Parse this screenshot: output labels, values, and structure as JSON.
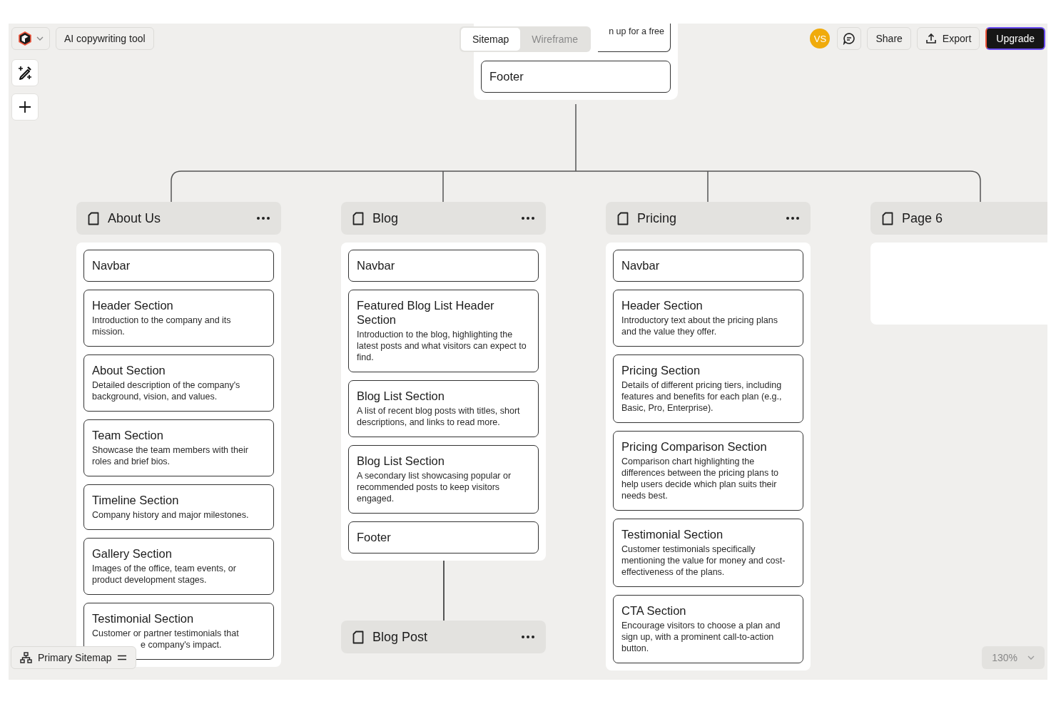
{
  "toolbar": {
    "project": "AI copywriting tool"
  },
  "view_tabs": [
    {
      "label": "Sitemap",
      "selected": true
    },
    {
      "label": "Wireframe",
      "selected": false
    }
  ],
  "header_actions": {
    "avatar": "VS",
    "share": "Share",
    "export": "Export",
    "upgrade": "Upgrade"
  },
  "root": {
    "cut_text": "n up for a free",
    "sections": [
      {
        "title": "Footer"
      }
    ]
  },
  "pages": [
    {
      "title": "About Us",
      "menu": true,
      "sections": [
        {
          "title": "Navbar"
        },
        {
          "title": "Header Section",
          "description": "Introduction to the company and its mission."
        },
        {
          "title": "About Section",
          "description": "Detailed description of the company's background, vision, and values."
        },
        {
          "title": "Team Section",
          "description": "Showcase the team members with their roles and brief bios."
        },
        {
          "title": "Timeline Section",
          "description": "Company history and major milestones."
        },
        {
          "title": "Gallery Section",
          "description": "Images of the office, team events, or product development stages."
        },
        {
          "title": "Testimonial Section",
          "description": "Customer or partner testimonials that",
          "description_tail": "e company's impact."
        }
      ]
    },
    {
      "title": "Blog",
      "menu": true,
      "sections": [
        {
          "title": "Navbar"
        },
        {
          "title": "Featured Blog List Header Section",
          "description": "Introduction to the blog, highlighting the latest posts and what visitors can expect to find."
        },
        {
          "title": "Blog List Section",
          "description": "A list of recent blog posts with titles, short descriptions, and links to read more."
        },
        {
          "title": "Blog List Section",
          "description": "A secondary list showcasing popular or recommended posts to keep visitors engaged."
        },
        {
          "title": "Footer"
        }
      ],
      "children": [
        {
          "title": "Blog Post",
          "menu": true
        }
      ]
    },
    {
      "title": "Pricing",
      "menu": true,
      "sections": [
        {
          "title": "Navbar"
        },
        {
          "title": "Header Section",
          "description": "Introductory text about the pricing plans and the value they offer."
        },
        {
          "title": "Pricing Section",
          "description": "Details of different pricing tiers, including features and benefits for each plan (e.g., Basic, Pro, Enterprise)."
        },
        {
          "title": "Pricing Comparison Section",
          "description": "Comparison chart highlighting the differences between the pricing plans to help users decide which plan suits their needs best."
        },
        {
          "title": "Testimonial Section",
          "description": "Customer testimonials specifically mentioning the value for money and cost-effectiveness of the plans."
        },
        {
          "title": "CTA Section",
          "description": "Encourage visitors to choose a plan and sign up, with a prominent call-to-action button."
        }
      ]
    },
    {
      "title": "Page 6"
    }
  ],
  "sitemap_switcher": {
    "label": "Primary Sitemap"
  },
  "zoom": {
    "value": "130%"
  }
}
